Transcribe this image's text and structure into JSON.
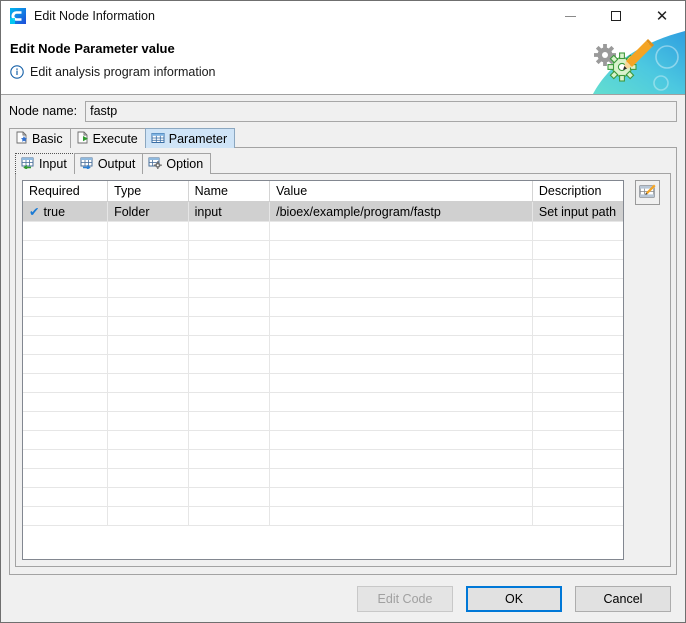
{
  "window": {
    "title": "Edit Node Information",
    "app_icon": "app-logo-icon",
    "controls": {
      "minimize": "minimize-icon",
      "maximize": "maximize-icon",
      "close": "close-icon"
    }
  },
  "header": {
    "title": "Edit Node Parameter value",
    "subtitle": "Edit analysis program information",
    "info_icon": "info-icon",
    "banner_icon": "gears-pencil-banner-icon"
  },
  "node_name": {
    "label": "Node name:",
    "value": "fastp",
    "placeholder": ""
  },
  "outer_tabs": [
    {
      "label": "Basic",
      "icon": "document-star-icon",
      "active": false
    },
    {
      "label": "Execute",
      "icon": "document-run-icon",
      "active": false
    },
    {
      "label": "Parameter",
      "icon": "table-icon",
      "active": true
    }
  ],
  "inner_tabs": [
    {
      "label": "Input",
      "icon": "table-import-icon",
      "active": true
    },
    {
      "label": "Output",
      "icon": "table-export-icon",
      "active": false
    },
    {
      "label": "Option",
      "icon": "table-gear-icon",
      "active": false
    }
  ],
  "parameter_table": {
    "columns": [
      "Required",
      "Type",
      "Name",
      "Value",
      "Description"
    ],
    "rows": [
      {
        "required": "true",
        "required_check": "✔",
        "type": "Folder",
        "name": "input",
        "value": "/bioex/example/program/fastp",
        "description": "Set input path",
        "selected": true
      }
    ],
    "empty_row_count": 16
  },
  "side_tools": {
    "edit_row_button": "edit-row-icon"
  },
  "footer": {
    "edit_code_label": "Edit Code",
    "edit_code_enabled": false,
    "ok_label": "OK",
    "cancel_label": "Cancel"
  },
  "colors": {
    "accent": "#0078d7",
    "active_tab": "#cfe4f7",
    "selection": "#d0d0d0",
    "check": "#1a7ad4",
    "banner_cyan": "#5fd0d8",
    "banner_blue": "#35a8e0",
    "pencil_orange": "#f4a424"
  }
}
